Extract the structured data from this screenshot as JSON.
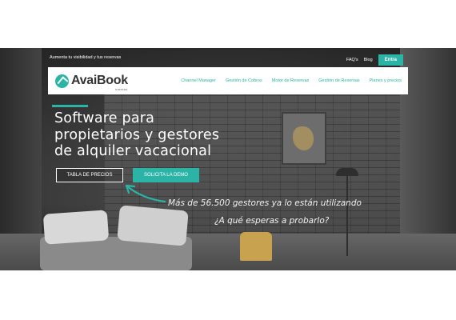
{
  "topbar": {
    "tagline": "Aumenta tu visibilidad y tus reservas",
    "faq_link": "FAQ's",
    "blog_link": "Blog",
    "login_button": "Entra"
  },
  "logo": {
    "name": "AvaiBook",
    "sub": "SIDDIKE"
  },
  "nav": {
    "items": [
      {
        "label": "Channel Manager"
      },
      {
        "label": "Gestión de Cobros"
      },
      {
        "label": "Motor de Reservas"
      },
      {
        "label": "Gestión de Reservas"
      },
      {
        "label": "Planes y precios"
      }
    ]
  },
  "hero": {
    "headline_lines": [
      "Software para",
      "propietarios y gestores",
      "de alquiler vacacional"
    ],
    "prices_button": "TABLA DE PRECIOS",
    "demo_button": "SOLICITA LA DEMO",
    "handwritten_line1": "Más de 56.500 gestores ya lo están utilizando",
    "handwritten_line2": "¿A qué esperas a probarlo?"
  },
  "colors": {
    "accent": "#2bb3a6",
    "nav_bg": "#ffffff",
    "hero_text": "#ffffff"
  },
  "icons": {
    "logo_mark": "avaibook-logo-icon",
    "arrow": "curved-arrow-icon"
  }
}
